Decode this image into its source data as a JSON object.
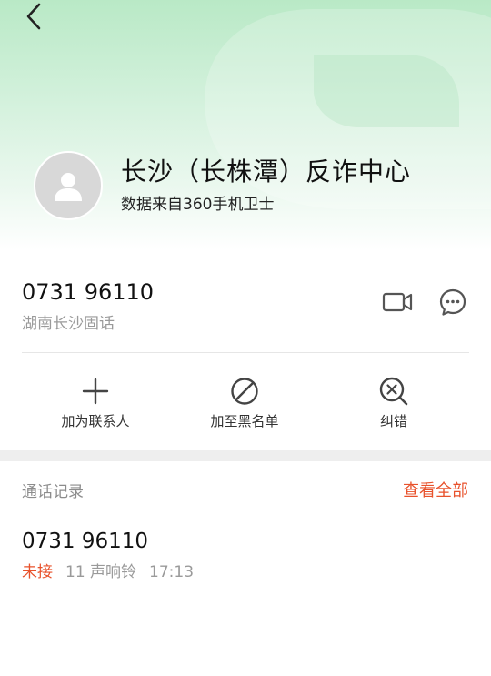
{
  "header": {
    "back_icon": "chevron-left-icon",
    "avatar_icon": "person-icon",
    "name": "长沙（长株潭）反诈中心",
    "source": "数据来自360手机卫士",
    "accent_color": "#b9e9c6"
  },
  "number_info": {
    "number": "0731 96110",
    "location": "湖南长沙固话",
    "video_icon": "video-call-icon",
    "message_icon": "message-icon"
  },
  "actions": [
    {
      "icon": "plus-icon",
      "label": "加为联系人"
    },
    {
      "icon": "block-icon",
      "label": "加至黑名单"
    },
    {
      "icon": "correct-icon",
      "label": "纠错"
    }
  ],
  "call_log": {
    "title": "通话记录",
    "view_all": "查看全部",
    "accent_color": "#e8522c",
    "entries": [
      {
        "number": "0731 96110",
        "status": "未接",
        "rings": "11 声响铃",
        "time": "17:13"
      }
    ]
  }
}
